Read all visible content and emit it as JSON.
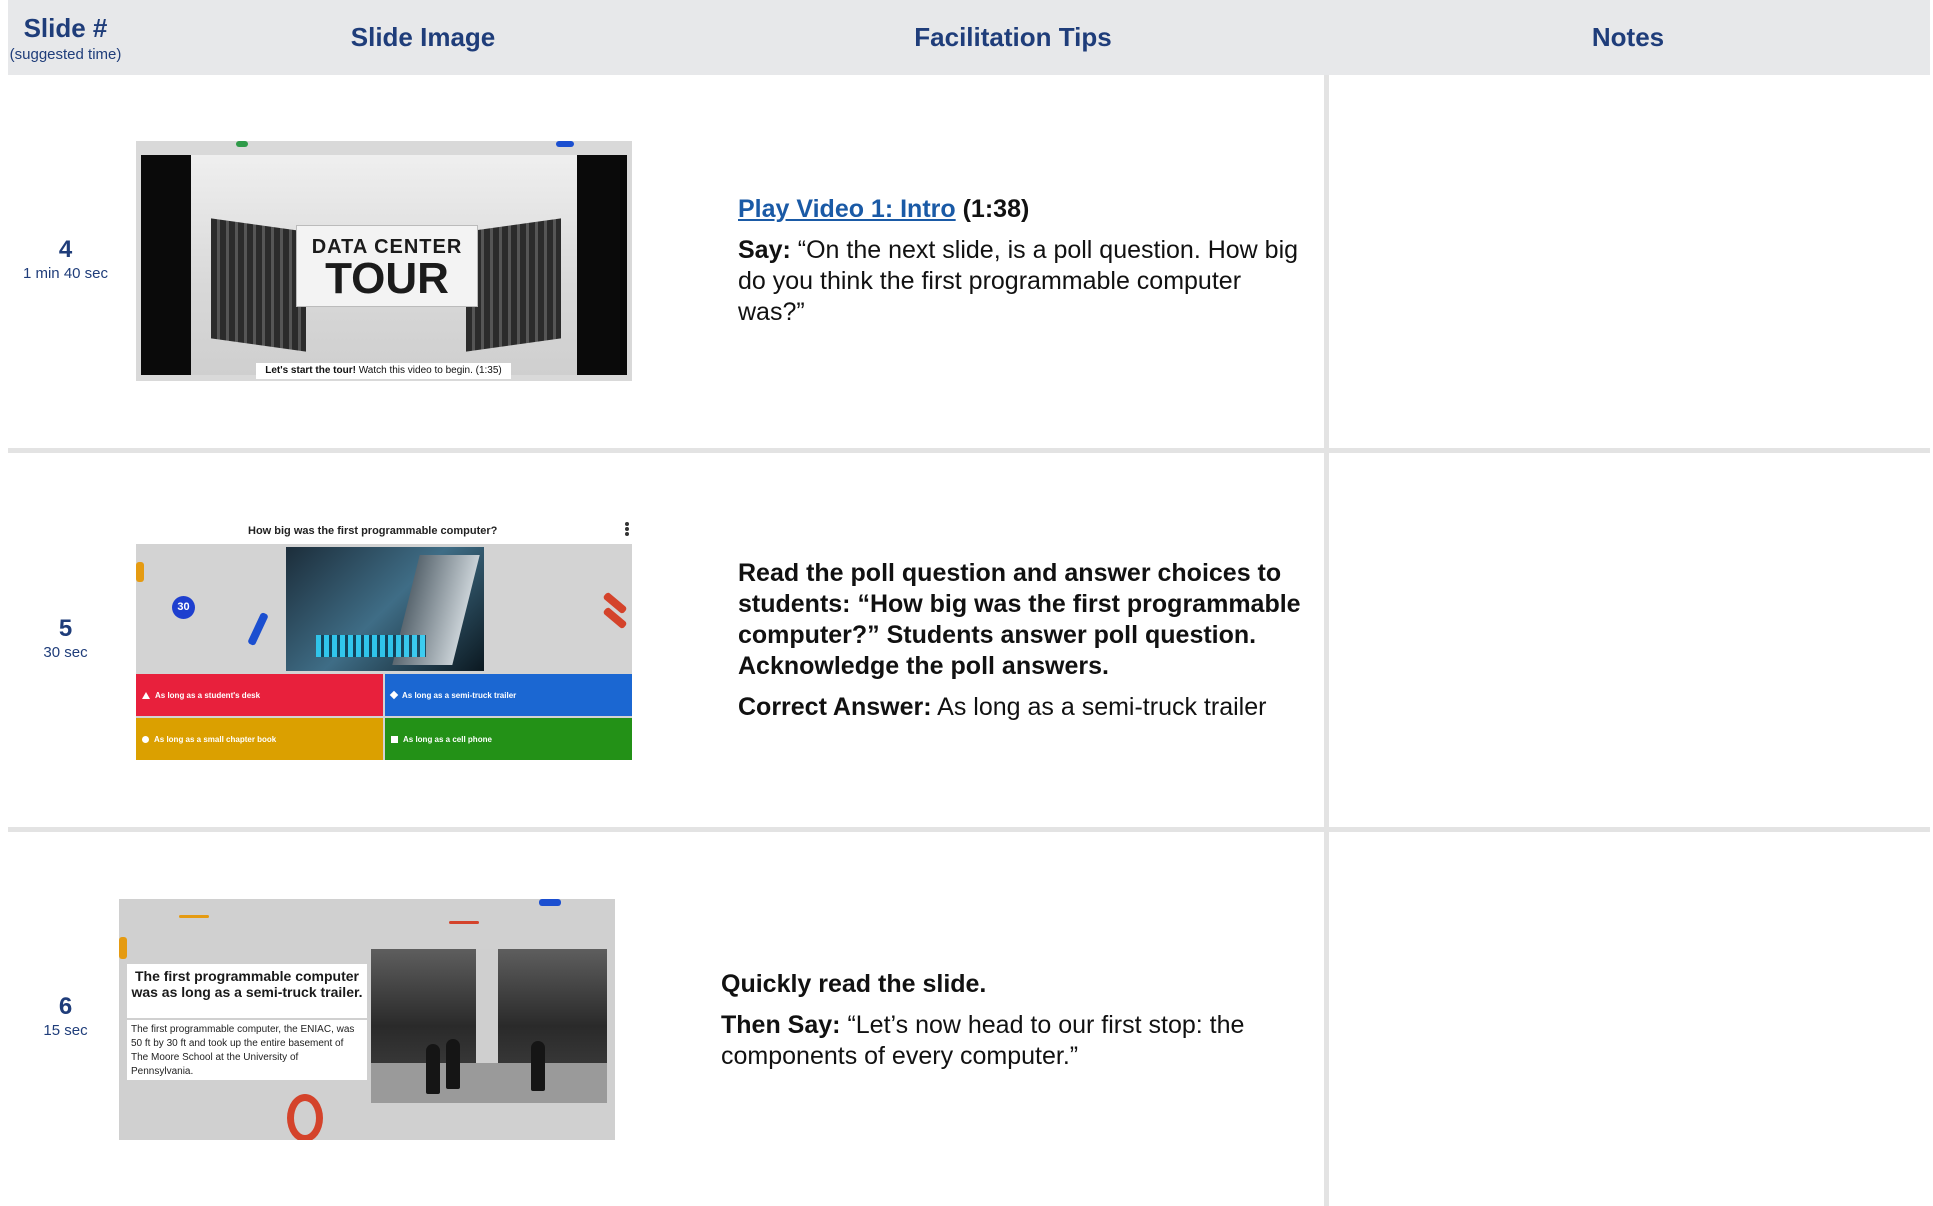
{
  "header": {
    "slide_num_label": "Slide #",
    "slide_num_sub": "(suggested time)",
    "slide_image_label": "Slide Image",
    "tips_label": "Facilitation Tips",
    "notes_label": "Notes"
  },
  "rows": [
    {
      "number": "4",
      "time": "1 min 40 sec",
      "tips": {
        "link_text": "Play Video 1: Intro",
        "duration": "(1:38)",
        "say_label": "Say:",
        "say_text": "“On the next slide, is a poll question. How big do you think the first programmable computer was?”"
      },
      "slide": {
        "title_small": "DATA CENTER",
        "title_big": "TOUR",
        "caption_bold": "Let's start the tour!",
        "caption_rest": "Watch this video to begin. (1:35)"
      }
    },
    {
      "number": "5",
      "time": "30 sec",
      "tips": {
        "bold_text": "Read the poll question and answer choices to students: “How big was the first programmable computer?” Students answer poll question. Acknowledge the poll answers.",
        "answer_label": "Correct Answer:",
        "answer_text": "As long as a semi-truck trailer"
      },
      "slide": {
        "question": "How big was the first programmable computer?",
        "timer": "30",
        "answers": [
          {
            "text": "As long as a student's desk",
            "color": "#e8203c"
          },
          {
            "text": "As long as a semi-truck trailer",
            "color": "#1b67d2"
          },
          {
            "text": "As long as a small chapter book",
            "color": "#dba000"
          },
          {
            "text": "As long as a cell phone",
            "color": "#239117"
          }
        ]
      }
    },
    {
      "number": "6",
      "time": "15 sec",
      "tips": {
        "bold_text": "Quickly read the slide.",
        "say_label": "Then Say:",
        "say_text": "“Let’s now head to our first stop: the components of every computer.”"
      },
      "slide": {
        "heading": "The first programmable computer was as long as a semi-truck trailer.",
        "body": "The first programmable computer, the ENIAC, was 50 ft by 30 ft and took up the entire basement of The Moore School at the University of Pennsylvania."
      }
    }
  ],
  "colors": {
    "header_bg": "#e7e8ea",
    "header_text": "#1f3d7a",
    "link": "#1a5aa6"
  }
}
